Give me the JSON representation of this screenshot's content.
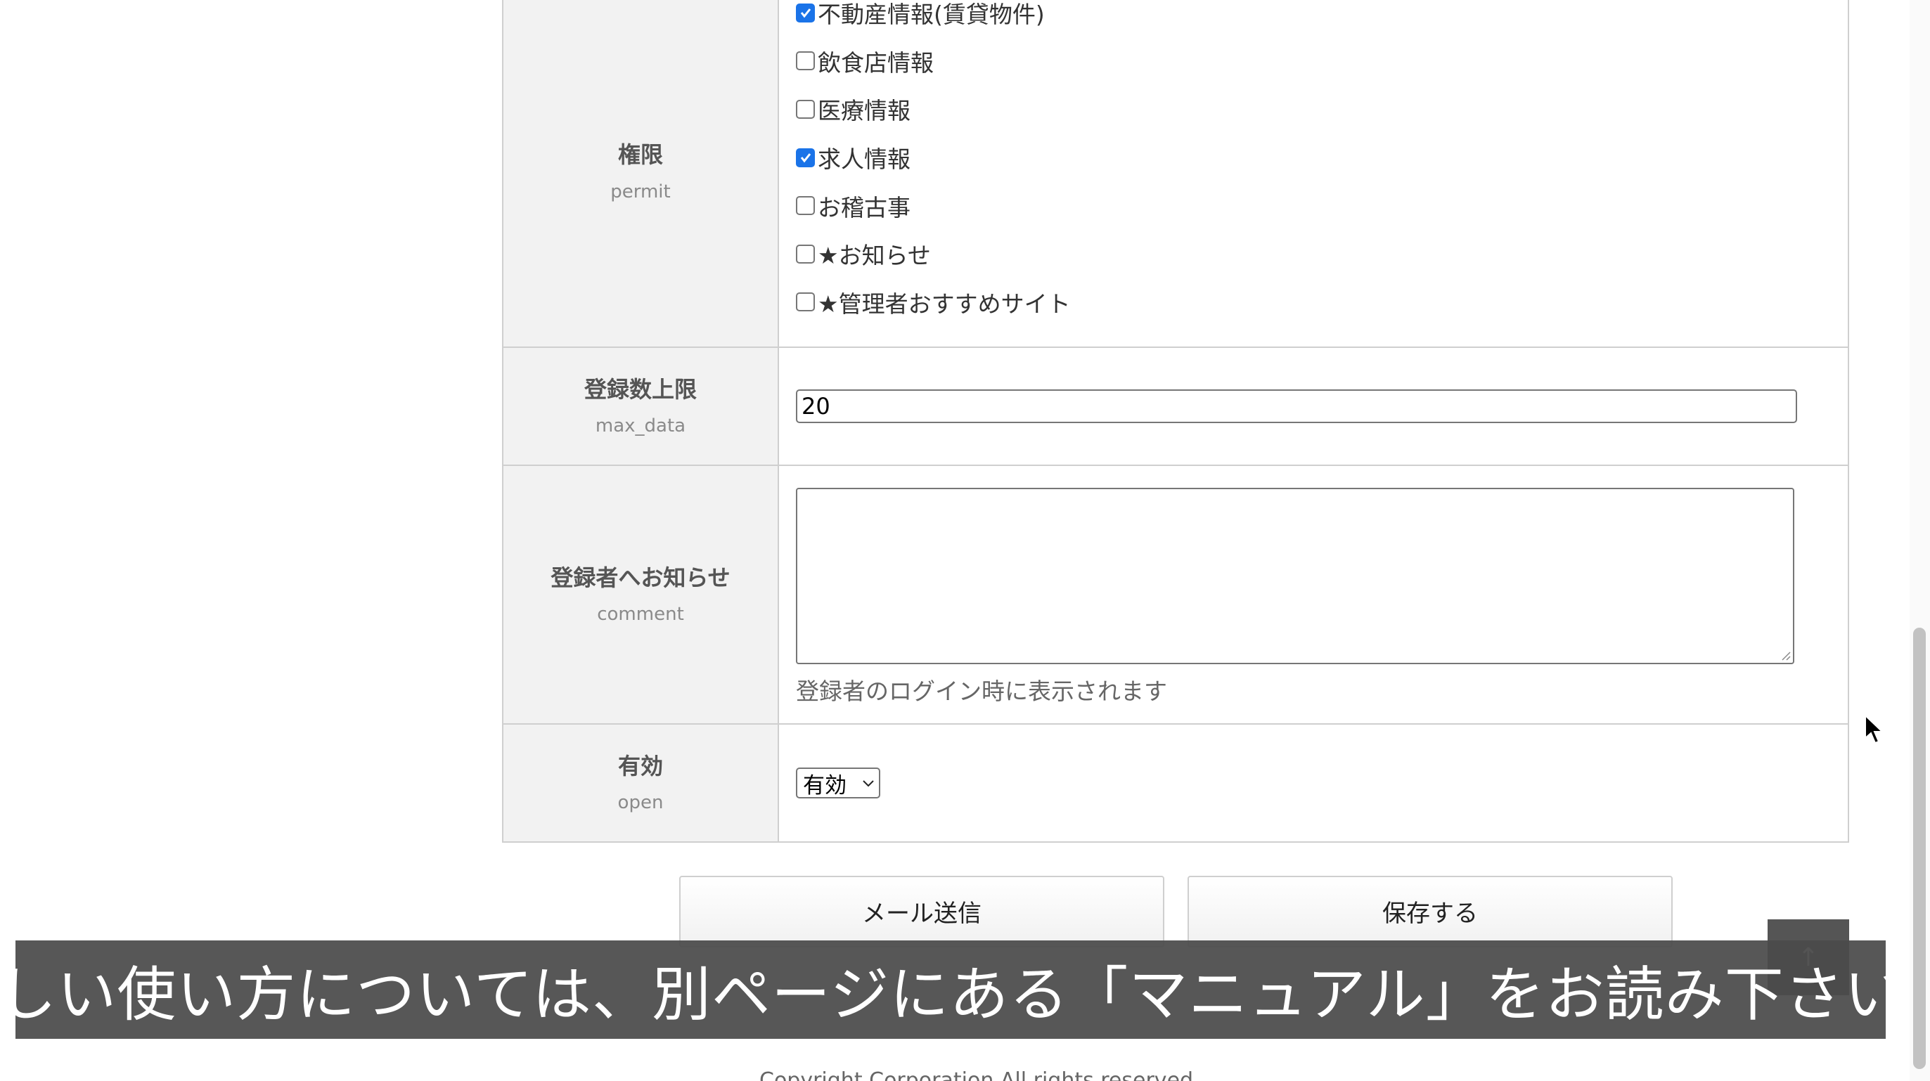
{
  "form": {
    "permit": {
      "label": "権限",
      "key": "permit",
      "options": [
        {
          "label": "不動産情報(賃貸物件)",
          "checked": true
        },
        {
          "label": "飲食店情報",
          "checked": false
        },
        {
          "label": "医療情報",
          "checked": false
        },
        {
          "label": "求人情報",
          "checked": true
        },
        {
          "label": "お稽古事",
          "checked": false
        },
        {
          "label": "★お知らせ",
          "checked": false
        },
        {
          "label": "★管理者おすすめサイト",
          "checked": false
        }
      ]
    },
    "max_data": {
      "label": "登録数上限",
      "key": "max_data",
      "value": "20"
    },
    "comment": {
      "label": "登録者へお知らせ",
      "key": "comment",
      "value": "",
      "help": "登録者のログイン時に表示されます"
    },
    "open": {
      "label": "有効",
      "key": "open",
      "selected": "有効"
    }
  },
  "buttons": {
    "mail_label": "メール送信",
    "save_label": "保存する"
  },
  "to_top_label": "↑",
  "subtitle": "詳しい使い方については、別ページにある「マニュアル」をお読み下さい。",
  "footer_partial": "Copyright Corporation All rights reserved.",
  "colors": {
    "checkbox_checked": "#1a73e8",
    "label_bg": "#f2f2f2",
    "border": "#cfcfcf",
    "subtitle_bg": "#4a4a4a"
  }
}
